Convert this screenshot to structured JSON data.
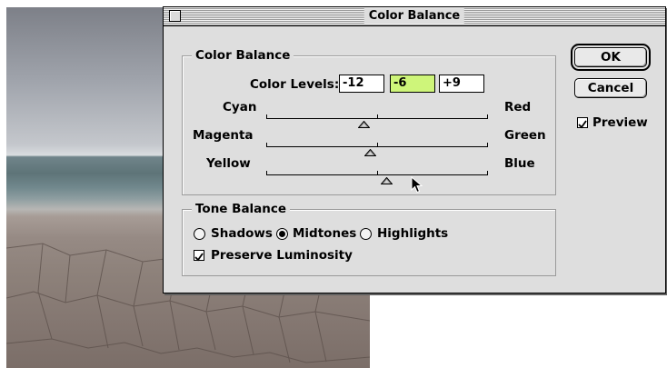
{
  "window": {
    "title": "Color Balance"
  },
  "color_balance": {
    "group_label": "Color Balance",
    "levels_label": "Color Levels:",
    "levels": [
      "-12",
      "-6",
      "+9"
    ],
    "sliders": [
      {
        "left": "Cyan",
        "right": "Red",
        "value": -12
      },
      {
        "left": "Magenta",
        "right": "Green",
        "value": -6
      },
      {
        "left": "Yellow",
        "right": "Blue",
        "value": 9
      }
    ],
    "slider_range": [
      -100,
      100
    ]
  },
  "tone_balance": {
    "group_label": "Tone Balance",
    "options": [
      "Shadows",
      "Midtones",
      "Highlights"
    ],
    "selected": "Midtones",
    "preserve_luminosity": {
      "label": "Preserve Luminosity",
      "checked": true
    }
  },
  "buttons": {
    "ok": "OK",
    "cancel": "Cancel"
  },
  "preview": {
    "label": "Preview",
    "checked": true
  },
  "colors": {
    "selected_field": "#cef57a"
  }
}
